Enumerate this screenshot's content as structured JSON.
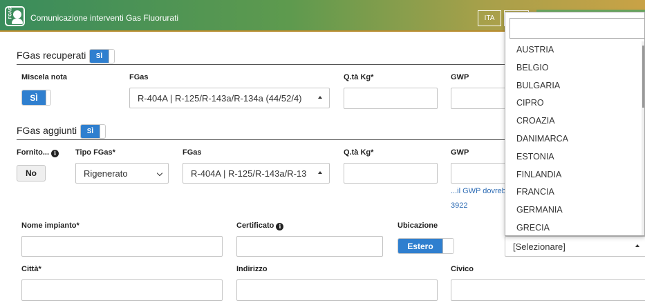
{
  "header": {
    "logo_text": "FGAS",
    "title": "Comunicazione interventi Gas Fluorurati",
    "lang_current": "ITA",
    "lang_other": ""
  },
  "recuperati": {
    "title": "FGas recuperati",
    "toggle": "SÌ",
    "miscela_label": "Miscela nota",
    "miscela_toggle": "SÌ",
    "fgas_label": "FGas",
    "fgas_value": "R-404A | R-125/R-143a/R-134a (44/52/4)",
    "qta_label": "Q.tà Kg*",
    "gwp_label": "GWP"
  },
  "aggiunti": {
    "title": "FGas aggiunti",
    "toggle": "SÌ",
    "fornito_label": "Fornito...",
    "fornito_value": "No",
    "tipo_label": "Tipo FGas*",
    "tipo_value": "Rigenerato",
    "fgas_label": "FGas",
    "fgas_value": "R-404A | R-125/R-143a/R-13",
    "qta_label": "Q.tà Kg*",
    "gwp_label": "GWP",
    "gwp_note": "...il GWP dovreb",
    "gwp_number": "3922"
  },
  "impianto": {
    "nome_label": "Nome impianto*",
    "certificato_label": "Certificato",
    "ubicazione_label": "Ubicazione",
    "ubicazione_value": "Estero",
    "country_select": "[Selezionare]",
    "citta_label": "Città*",
    "indirizzo_label": "Indirizzo",
    "civico_label": "Civico"
  },
  "dropdown": {
    "search_placeholder": "",
    "countries": [
      "AUSTRIA",
      "BELGIO",
      "BULGARIA",
      "CIPRO",
      "CROAZIA",
      "DANIMARCA",
      "ESTONIA",
      "FINLANDIA",
      "FRANCIA",
      "GERMANIA",
      "GRECIA"
    ]
  },
  "colors": {
    "accent": "#2f7fcf",
    "header_green": "#3a8c5c",
    "header_gold": "#c9a246",
    "link": "#2f6db5"
  }
}
